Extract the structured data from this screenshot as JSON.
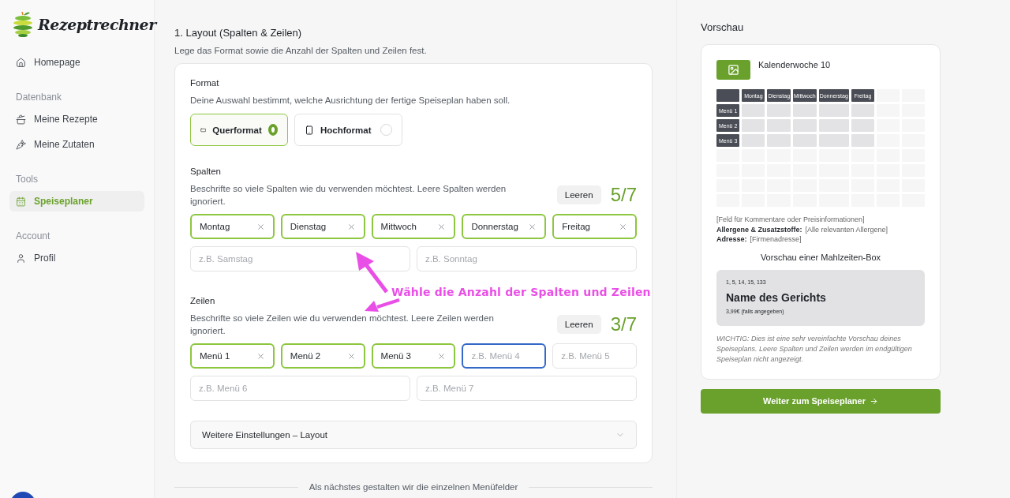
{
  "sidebar": {
    "logo": "Rezeptrechner",
    "groups": [
      {
        "items": [
          {
            "label": "Homepage",
            "selected": false
          }
        ]
      },
      {
        "heading": "Datenbank",
        "items": [
          {
            "label": "Meine Rezepte",
            "selected": false
          },
          {
            "label": "Meine Zutaten",
            "selected": false
          }
        ]
      },
      {
        "heading": "Tools",
        "items": [
          {
            "label": "Speiseplaner",
            "selected": true
          }
        ]
      },
      {
        "heading": "Account",
        "items": [
          {
            "label": "Profil",
            "selected": false
          }
        ]
      }
    ]
  },
  "section": {
    "title": "1. Layout (Spalten & Zeilen)",
    "subtitle": "Lege das Format sowie die Anzahl der Spalten und Zeilen fest."
  },
  "format": {
    "label": "Format",
    "description": "Deine Auswahl bestimmt, welche Ausrichtung der fertige Speiseplan haben soll.",
    "options": [
      {
        "label": "Querformat",
        "selected": true
      },
      {
        "label": "Hochformat",
        "selected": false
      }
    ]
  },
  "columns": {
    "label": "Spalten",
    "description": "Beschrifte so viele Spalten wie du verwenden möchtest. Leere Spalten werden ignoriert.",
    "clear_button": "Leeren",
    "count": "5/7",
    "fields": [
      {
        "value": "Montag",
        "focused": false
      },
      {
        "value": "Dienstag",
        "focused": false
      },
      {
        "value": "Mittwoch",
        "focused": false
      },
      {
        "value": "Donnerstag",
        "focused": false
      },
      {
        "value": "Freitag",
        "focused": false
      },
      {
        "placeholder": "z.B. Samstag",
        "focused": false
      },
      {
        "placeholder": "z.B. Sonntag",
        "focused": false
      }
    ]
  },
  "rows": {
    "label": "Zeilen",
    "description": "Beschrifte so viele Zeilen wie du verwenden möchtest. Leere Zeilen werden ignoriert.",
    "clear_button": "Leeren",
    "count": "3/7",
    "fields": [
      {
        "value": "Menü 1",
        "focused": false
      },
      {
        "value": "Menü 2",
        "focused": false
      },
      {
        "value": "Menü 3",
        "focused": false
      },
      {
        "placeholder": "z.B. Menü 4",
        "focused": true
      },
      {
        "placeholder": "z.B. Menü 5",
        "focused": false
      },
      {
        "placeholder": "z.B. Menü 6",
        "focused": false
      },
      {
        "placeholder": "z.B. Menü 7",
        "focused": false
      }
    ]
  },
  "accordion": {
    "label": "Weitere Einstellungen – Layout",
    "expanded": false
  },
  "next_step": "Als nächstes gestalten wir die einzelnen Menüfelder",
  "annotation": "Wähle die Anzahl der Spalten und Zeilen",
  "preview": {
    "heading": "Vorschau",
    "title": "Kalenderwoche 10",
    "grid_columns": [
      "Montag",
      "Dienstag",
      "Mittwoch",
      "Donnerstag",
      "Freitag"
    ],
    "grid_rows": [
      "Menü 1",
      "Menü 2",
      "Menü 3"
    ],
    "comment": "[Feld für Kommentare oder Preisinformationen]",
    "allergens_label": "Allergene & Zusatzstoffe:",
    "allergens_value": "[Alle relevanten Allergene]",
    "address_label": "Adresse:",
    "address_value": "[Firmenadresse]",
    "meal_heading": "Vorschau einer Mahlzeiten-Box",
    "meal": {
      "numbers": "1, 5, 14, 15, 133",
      "name": "Name des Gerichts",
      "price": "3,99€ (falls angegeben)"
    },
    "note": "WICHTIG: Dies ist eine sehr vereinfachte Vorschau deines Speiseplans. Leere Spalten und Zeilen werden im endgültigen Speiseplan nicht angezeigt."
  },
  "continue_button": "Weiter zum Speiseplaner"
}
